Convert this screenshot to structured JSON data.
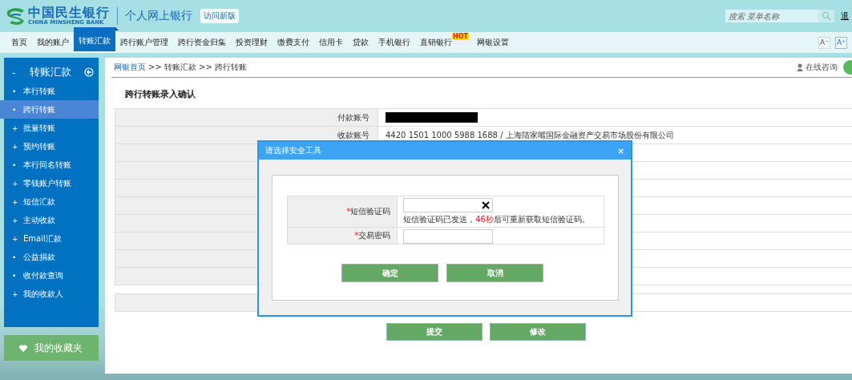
{
  "header": {
    "bank_name": "中国民生银行",
    "bank_name_en": "CHINA MINSHENG BANK",
    "product": "个人网上银行",
    "new_version_link": "访问新版",
    "search": {
      "placeholder": "搜索 菜单名称"
    },
    "logout": "退"
  },
  "nav": {
    "tabs": [
      {
        "label": "首页",
        "selected": false
      },
      {
        "label": "我的账户",
        "selected": false
      },
      {
        "label": "转账汇款",
        "selected": true
      },
      {
        "label": "跨行账户管理",
        "selected": false
      },
      {
        "label": "跨行资金归集",
        "selected": false
      },
      {
        "label": "投资理财",
        "selected": false
      },
      {
        "label": "缴费支付",
        "selected": false
      },
      {
        "label": "信用卡",
        "selected": false
      },
      {
        "label": "贷款",
        "selected": false
      },
      {
        "label": "手机银行",
        "selected": false
      },
      {
        "label": "直销银行",
        "selected": false,
        "badge": "HOT"
      },
      {
        "label": "网银设置",
        "selected": false
      }
    ],
    "font_buttons": [
      "A⁻",
      "A⁺"
    ]
  },
  "sidebar": {
    "title_marker": "-",
    "title": "转账汇款",
    "items": [
      {
        "marker": "•",
        "label": "本行转账",
        "selected": false
      },
      {
        "marker": "•",
        "label": "跨行转账",
        "selected": true
      },
      {
        "marker": "+",
        "label": "批量转账",
        "selected": false
      },
      {
        "marker": "+",
        "label": "预约转账",
        "selected": false
      },
      {
        "marker": "•",
        "label": "本行同名转账",
        "selected": false
      },
      {
        "marker": "+",
        "label": "零钱账户转账",
        "selected": false
      },
      {
        "marker": "+",
        "label": "短信汇款",
        "selected": false
      },
      {
        "marker": "+",
        "label": "主动收款",
        "selected": false
      },
      {
        "marker": "+",
        "label": "Email汇款",
        "selected": false
      },
      {
        "marker": "•",
        "label": "公益捐款",
        "selected": false
      },
      {
        "marker": "•",
        "label": "收付款查询",
        "selected": false
      },
      {
        "marker": "+",
        "label": "我的收款人",
        "selected": false
      }
    ],
    "favorites": "我的收藏夹"
  },
  "main": {
    "breadcrumb": {
      "home": "网银首页",
      "trail": ">> 转账汇款 >> 跨行转账"
    },
    "consult": "在线咨询",
    "title": "跨行转账录入确认",
    "rows": [
      {
        "kind": "redacted",
        "label": "付款账号"
      },
      {
        "kind": "text",
        "label": "收款账号",
        "value": "4420 1501 1000 5988 1688 / 上海陆家嘴国际金融资产交易市场股份有限公司"
      },
      {
        "kind": "covered"
      },
      {
        "kind": "covered"
      },
      {
        "kind": "covered"
      },
      {
        "kind": "covered"
      },
      {
        "kind": "covered"
      },
      {
        "kind": "covered"
      },
      {
        "kind": "covered"
      },
      {
        "kind": "covered"
      }
    ],
    "summary_rows": [
      {
        "kind": "covered"
      }
    ],
    "buttons": [
      "提交",
      "修改"
    ]
  },
  "dialog": {
    "title": "请选择安全工具",
    "close": "×",
    "fields": [
      {
        "required_mark": "*",
        "label": "短信验证码",
        "clearable": true,
        "notice": {
          "before": "短信验证码已发送，",
          "countdown": "46秒",
          "after": "后可重新获取短信验证码。"
        }
      },
      {
        "required_mark": "*",
        "label": "交易密码",
        "clearable": false
      }
    ],
    "buttons": [
      "确定",
      "取消"
    ]
  }
}
